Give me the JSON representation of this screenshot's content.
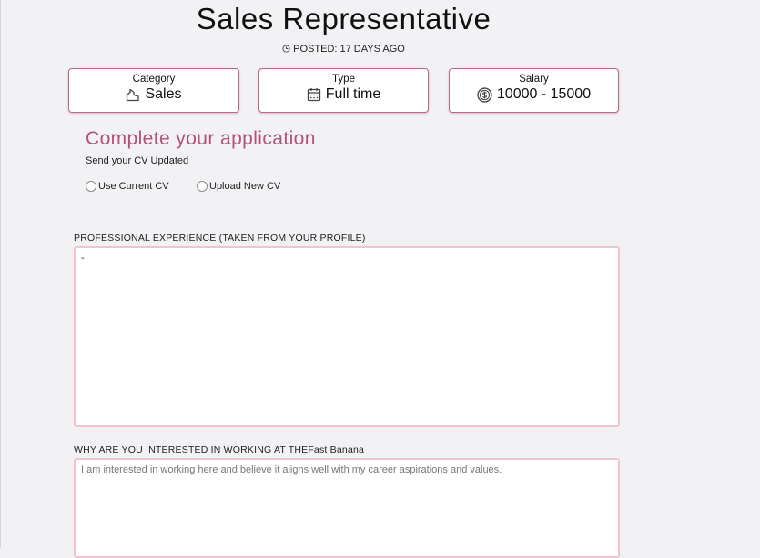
{
  "job": {
    "title": "Sales Representative",
    "posted": "POSTED: 17 DAYS AGO"
  },
  "cards": {
    "category": {
      "label": "Category",
      "value": "Sales",
      "icon": "chart-icon"
    },
    "type": {
      "label": "Type",
      "value": "Full time",
      "icon": "calendar-icon"
    },
    "salary": {
      "label": "Salary",
      "value": "10000 - 15000",
      "icon": "dollar-coin-icon"
    }
  },
  "application": {
    "title": "Complete your application",
    "subtitle": "Send your CV Updated",
    "cv_options": [
      "Use Current CV",
      "Upload New CV"
    ]
  },
  "fields": {
    "experience": {
      "label": "PROFESSIONAL EXPERIENCE (TAKEN FROM YOUR PROFILE)",
      "value": "-"
    },
    "interest": {
      "label": "WHY ARE YOU INTERESTED IN WORKING AT THEFast Banana",
      "placeholder": "I am interested in working here and believe it aligns well with my career aspirations and values.",
      "value": ""
    }
  },
  "colors": {
    "accent": "#b5527c",
    "card_border": "#b76b8a",
    "textarea_border": "#f0c4d0",
    "background": "#f2f1f4"
  }
}
